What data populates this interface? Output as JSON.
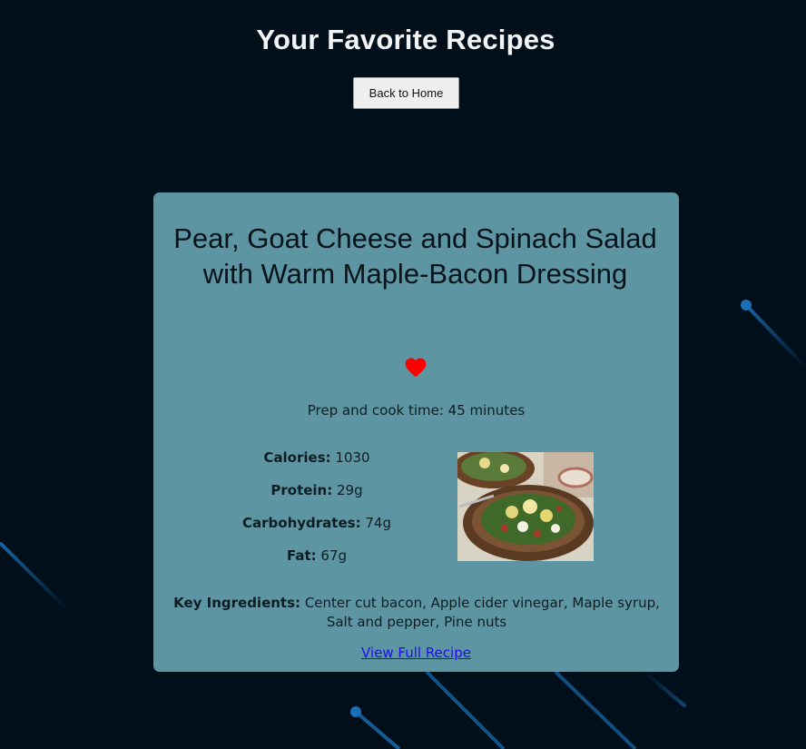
{
  "page": {
    "title": "Your Favorite Recipes"
  },
  "nav": {
    "back_label": "Back to Home"
  },
  "colors": {
    "background": "#010f1b",
    "card": "#5e95a2",
    "heart": "#ff0000",
    "link": "#1a0ff0",
    "streak": "#1a6fb5"
  },
  "recipe": {
    "title": "Pear, Goat Cheese and Spinach Salad with Warm Maple-Bacon Dressing",
    "favorite_icon": "heart-icon",
    "prep_time": "Prep and cook time: 45 minutes",
    "nutrition": [
      {
        "label": "Calories:",
        "value": "1030"
      },
      {
        "label": "Protein:",
        "value": "29g"
      },
      {
        "label": "Carbohydrates:",
        "value": "74g"
      },
      {
        "label": "Fat:",
        "value": "67g"
      }
    ],
    "ingredients_label": "Key Ingredients:",
    "ingredients_text": "Center cut bacon, Apple cider vinegar, Maple syrup, Salt and pepper, Pine nuts",
    "link_label": "View Full Recipe"
  }
}
